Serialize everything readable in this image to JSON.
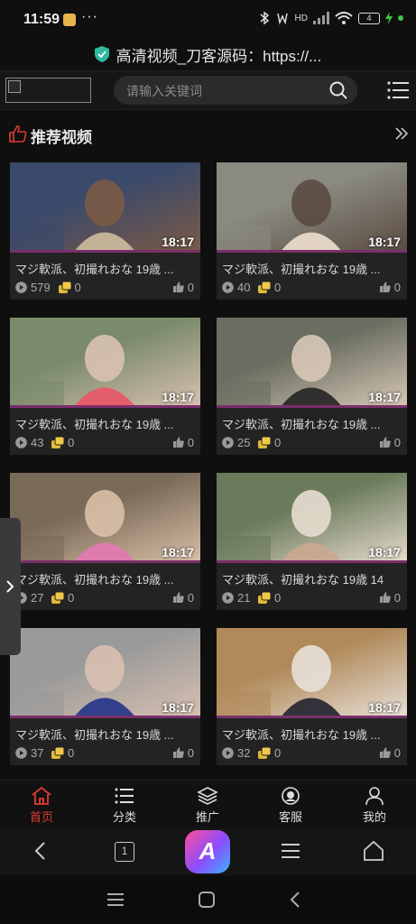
{
  "status_bar": {
    "time": "11:59",
    "dots": "···",
    "signal_text": "HD",
    "battery": "4"
  },
  "url_bar": {
    "text": "高清视频_刀客源码：https://..."
  },
  "header": {
    "search_placeholder": "请输入关键词"
  },
  "section": {
    "title": "推荐视频"
  },
  "videos": [
    {
      "title": "マジ軟派、初撮れおな 19歳 ...",
      "duration": "18:17",
      "views": "579",
      "coins": "0",
      "likes": "0",
      "palette": [
        "#3b4a6a",
        "#c9b79a",
        "#7b5a45"
      ]
    },
    {
      "title": "マジ軟派、初撮れおな 19歳 ...",
      "duration": "18:17",
      "views": "40",
      "coins": "0",
      "likes": "0",
      "palette": [
        "#8a8a80",
        "#e8d9c8",
        "#5a4a40"
      ]
    },
    {
      "title": "マジ軟派、初撮れおな 19歳 ...",
      "duration": "18:17",
      "views": "43",
      "coins": "0",
      "likes": "0",
      "palette": [
        "#7a8a6a",
        "#e85a6a",
        "#d9c2b0"
      ]
    },
    {
      "title": "マジ軟派、初撮れおな 19歳 ...",
      "duration": "18:17",
      "views": "25",
      "coins": "0",
      "likes": "0",
      "palette": [
        "#6a6e60",
        "#2a2a2a",
        "#d8c8b8"
      ]
    },
    {
      "title": "マジ軟派、初撮れおな 19歳 ...",
      "duration": "18:17",
      "views": "27",
      "coins": "0",
      "likes": "0",
      "palette": [
        "#7a6a58",
        "#e07ab0",
        "#d9c0a8"
      ]
    },
    {
      "title": "マジ軟派、初撮れおな 19歳 14",
      "duration": "18:17",
      "views": "21",
      "coins": "0",
      "likes": "0",
      "palette": [
        "#6a7a5a",
        "#c8a890",
        "#e8ddd0"
      ]
    },
    {
      "title": "マジ軟派、初撮れおな 19歳 ...",
      "duration": "18:17",
      "views": "37",
      "coins": "0",
      "likes": "0",
      "palette": [
        "#9a9a9a",
        "#2a3a8a",
        "#d8c0b0"
      ]
    },
    {
      "title": "マジ軟派、初撮れおな 19歳 ...",
      "duration": "18:17",
      "views": "32",
      "coins": "0",
      "likes": "0",
      "palette": [
        "#b08a5a",
        "#2a2a35",
        "#e8e0d8"
      ]
    }
  ],
  "tabs": [
    {
      "label": "首页",
      "icon": "home-icon",
      "active": true
    },
    {
      "label": "分类",
      "icon": "list-icon",
      "active": false
    },
    {
      "label": "推广",
      "icon": "layers-icon",
      "active": false
    },
    {
      "label": "客服",
      "icon": "support-icon",
      "active": false
    },
    {
      "label": "我的",
      "icon": "user-icon",
      "active": false
    }
  ],
  "browser_nav": {
    "tab_count": "1"
  },
  "colors": {
    "accent": "#e23a2f",
    "card_bg": "#232323",
    "page_bg": "#0f0f0f"
  }
}
